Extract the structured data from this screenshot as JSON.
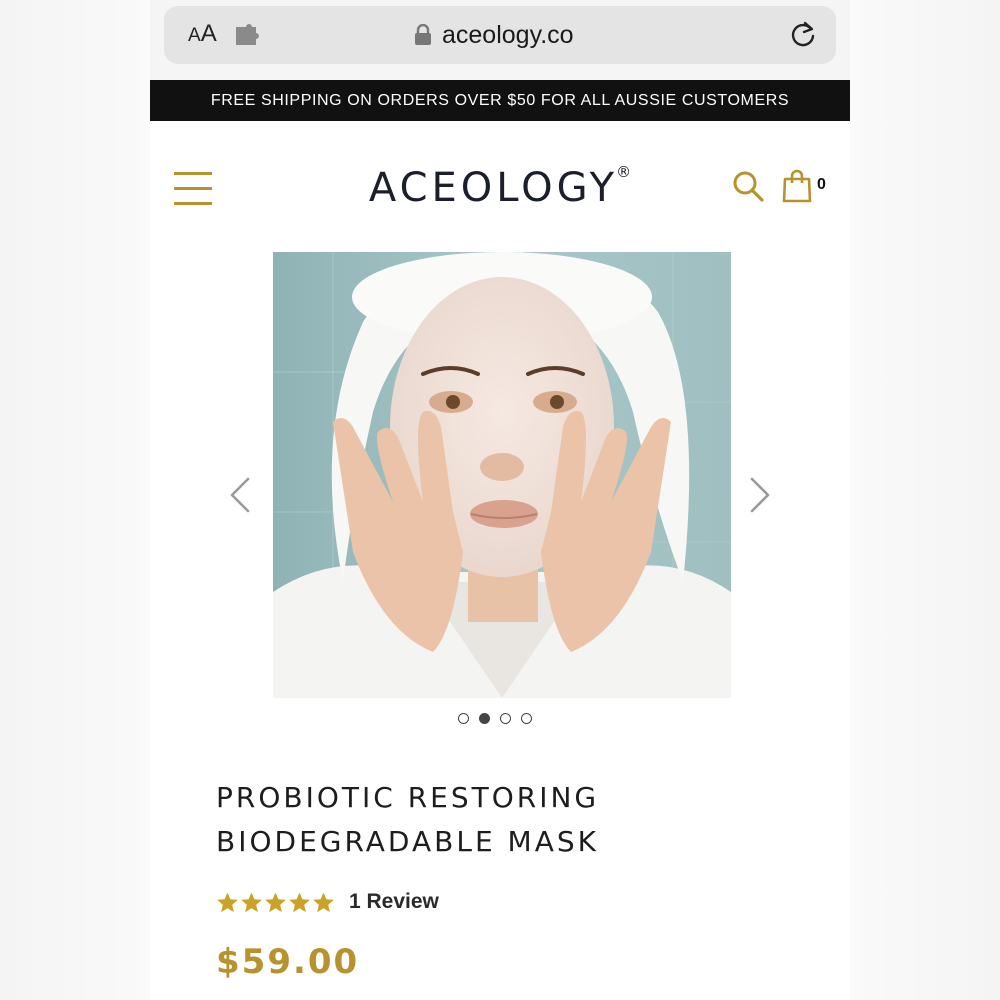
{
  "browser": {
    "text_size_small": "A",
    "text_size_large": "A",
    "url": "aceology.co"
  },
  "announcement": {
    "text": "FREE SHIPPING ON ORDERS OVER $50 FOR ALL AUSSIE CUSTOMERS"
  },
  "header": {
    "logo": "ACEOLOGY",
    "logo_mark": "®",
    "cart_count": "0"
  },
  "gallery": {
    "slide_count": 4,
    "active_index": 1
  },
  "product": {
    "title_line1": "PROBIOTIC RESTORING",
    "title_line2": "BIODEGRADABLE MASK",
    "rating": 5,
    "review_text": "1 Review",
    "price": "$59.00"
  },
  "colors": {
    "accent": "#b8922e",
    "announcement_bg": "#111111",
    "star": "#c9a227"
  }
}
